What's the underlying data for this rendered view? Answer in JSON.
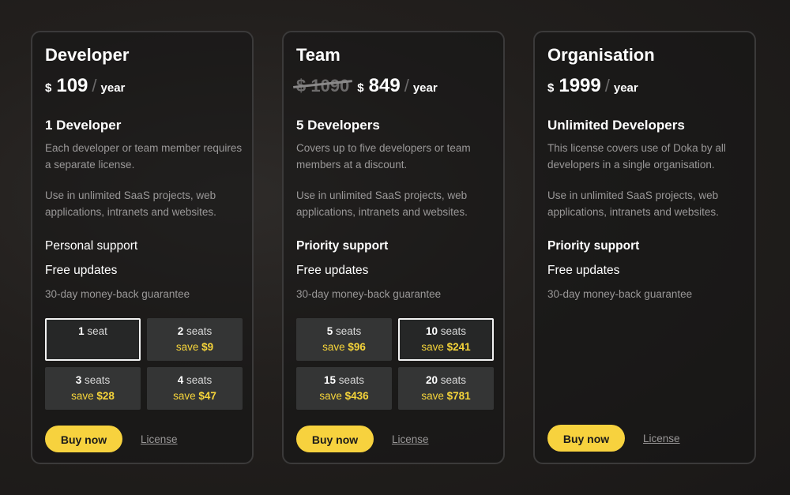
{
  "plans": [
    {
      "title": "Developer",
      "old_price": "",
      "currency": "$",
      "price": "109",
      "slash": "/",
      "per": "year",
      "headline": "1 Developer",
      "desc1": "Each developer or team member requires a separate license.",
      "desc2": "Use in unlimited SaaS projects, web applications, intranets and websites.",
      "support": "Personal support",
      "updates": "Free updates",
      "guarantee": "30-day money-back guarantee",
      "seat_options": [
        {
          "count": "1",
          "unit": "seat",
          "save_prefix": "",
          "save_amount": "",
          "selected": true
        },
        {
          "count": "2",
          "unit": "seats",
          "save_prefix": "save",
          "save_amount": "$9",
          "selected": false
        },
        {
          "count": "3",
          "unit": "seats",
          "save_prefix": "save",
          "save_amount": "$28",
          "selected": false
        },
        {
          "count": "4",
          "unit": "seats",
          "save_prefix": "save",
          "save_amount": "$47",
          "selected": false
        }
      ],
      "buy_label": "Buy now",
      "license_label": "License"
    },
    {
      "title": "Team",
      "old_price": "$ 1090",
      "currency": "$",
      "price": "849",
      "slash": "/",
      "per": "year",
      "headline": "5 Developers",
      "desc1": "Covers up to five developers or team members at a discount.",
      "desc2": "Use in unlimited SaaS projects, web applications, intranets and websites.",
      "support": "Priority support",
      "updates": "Free updates",
      "guarantee": "30-day money-back guarantee",
      "seat_options": [
        {
          "count": "5",
          "unit": "seats",
          "save_prefix": "save",
          "save_amount": "$96",
          "selected": false
        },
        {
          "count": "10",
          "unit": "seats",
          "save_prefix": "save",
          "save_amount": "$241",
          "selected": true
        },
        {
          "count": "15",
          "unit": "seats",
          "save_prefix": "save",
          "save_amount": "$436",
          "selected": false
        },
        {
          "count": "20",
          "unit": "seats",
          "save_prefix": "save",
          "save_amount": "$781",
          "selected": false
        }
      ],
      "buy_label": "Buy now",
      "license_label": "License"
    },
    {
      "title": "Organisation",
      "old_price": "",
      "currency": "$",
      "price": "1999",
      "slash": "/",
      "per": "year",
      "headline": "Unlimited Developers",
      "desc1": "This license covers use of Doka by all developers in a single organisation.",
      "desc2": "Use in unlimited SaaS projects, web applications, intranets and websites.",
      "support": "Priority support",
      "updates": "Free updates",
      "guarantee": "30-day money-back guarantee",
      "seat_options": [],
      "buy_label": "Buy now",
      "license_label": "License"
    }
  ],
  "colors": {
    "accent": "#f7d23e",
    "save_text": "#f5d43a",
    "muted_text": "#9a9898",
    "card_border": "#3b3a3a"
  }
}
